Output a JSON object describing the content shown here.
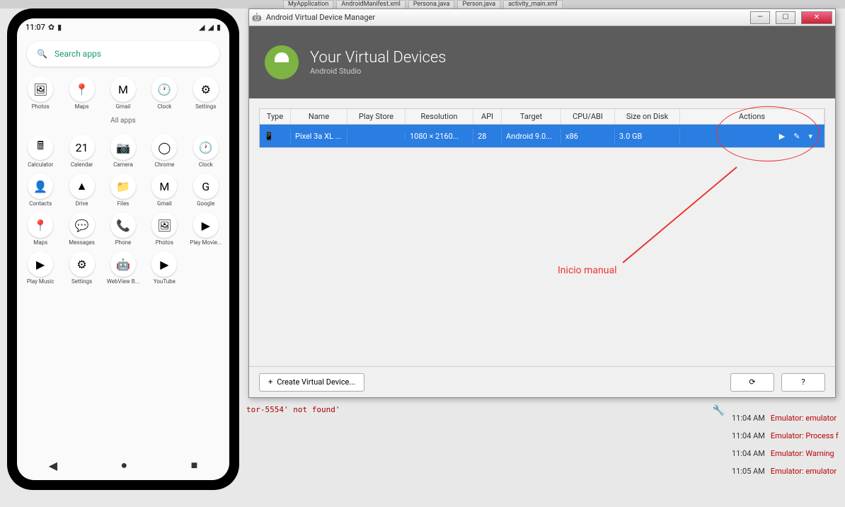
{
  "bg_tabs": [
    "MyApplication",
    "AndroidManifest.xml",
    "Persona.java",
    "Person.java",
    "activity_main.xml"
  ],
  "phone": {
    "time": "11:07",
    "search_placeholder": "Search apps",
    "all_apps_label": "All apps",
    "top_apps": [
      {
        "label": "Photos",
        "glyph": "🖼"
      },
      {
        "label": "Maps",
        "glyph": "📍"
      },
      {
        "label": "Gmail",
        "glyph": "M"
      },
      {
        "label": "Clock",
        "glyph": "🕐"
      },
      {
        "label": "Settings",
        "glyph": "⚙"
      }
    ],
    "grid_apps": [
      {
        "label": "Calculator",
        "glyph": "🖩"
      },
      {
        "label": "Calendar",
        "glyph": "21"
      },
      {
        "label": "Camera",
        "glyph": "📷"
      },
      {
        "label": "Chrome",
        "glyph": "◯"
      },
      {
        "label": "Clock",
        "glyph": "🕐"
      },
      {
        "label": "Contacts",
        "glyph": "👤"
      },
      {
        "label": "Drive",
        "glyph": "▲"
      },
      {
        "label": "Files",
        "glyph": "📁"
      },
      {
        "label": "Gmail",
        "glyph": "M"
      },
      {
        "label": "Google",
        "glyph": "G"
      },
      {
        "label": "Maps",
        "glyph": "📍"
      },
      {
        "label": "Messages",
        "glyph": "💬"
      },
      {
        "label": "Phone",
        "glyph": "📞"
      },
      {
        "label": "Photos",
        "glyph": "🖼"
      },
      {
        "label": "Play Movie...",
        "glyph": "▶"
      },
      {
        "label": "Play Music",
        "glyph": "▶"
      },
      {
        "label": "Settings",
        "glyph": "⚙"
      },
      {
        "label": "WebView B...",
        "glyph": "🤖"
      },
      {
        "label": "YouTube",
        "glyph": "▶"
      }
    ]
  },
  "avd": {
    "window_title": "Android Virtual Device Manager",
    "header_title": "Your Virtual Devices",
    "header_sub": "Android Studio",
    "columns": [
      "Type",
      "Name",
      "Play Store",
      "Resolution",
      "API",
      "Target",
      "CPU/ABI",
      "Size on Disk",
      "Actions"
    ],
    "row": {
      "name": "Pixel 3a XL ...",
      "resolution": "1080 × 2160...",
      "api": "28",
      "target": "Android 9.0...",
      "cpu": "x86",
      "size": "3.0 GB"
    },
    "create_btn": "Create Virtual Device...",
    "refresh_btn": "⟳",
    "help_btn": "?"
  },
  "annotation": "Inicio manual",
  "console_text": "tor-5554' not found'",
  "events": [
    {
      "time": "11:04 AM",
      "msg": "Emulator: emulator"
    },
    {
      "time": "11:04 AM",
      "msg": "Emulator: Process f"
    },
    {
      "time": "11:04 AM",
      "msg": "Emulator: Warning"
    },
    {
      "time": "11:05 AM",
      "msg": "Emulator: emulator"
    }
  ]
}
